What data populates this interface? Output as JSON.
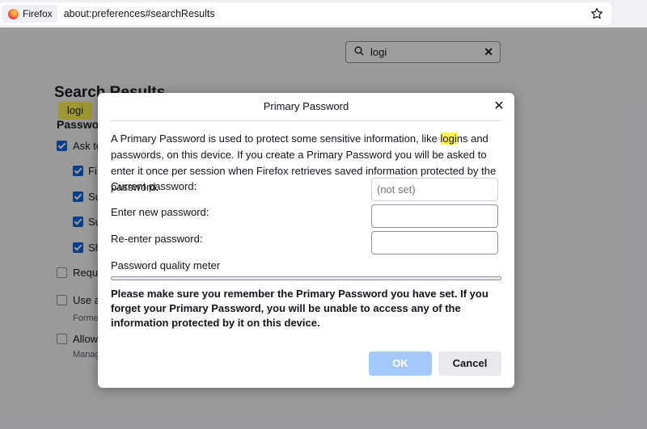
{
  "browser": {
    "identity_label": "Firefox",
    "url": "about:preferences#searchResults"
  },
  "page": {
    "search_query": "logi",
    "title": "Search Results",
    "chip": "logi",
    "section": "Passwo",
    "rows": [
      {
        "label": "Ask to",
        "checked": true
      },
      {
        "label": "Fi",
        "checked": true
      },
      {
        "label": "Su",
        "checked": true
      },
      {
        "label": "Su",
        "checked": true
      },
      {
        "label": "Sh",
        "checked": true
      },
      {
        "label": "Requi",
        "checked": false
      },
      {
        "label": "Use a",
        "checked": false,
        "sub": "Forme"
      },
      {
        "label": "Allow",
        "checked": false,
        "sub": "Manag"
      }
    ]
  },
  "dialog": {
    "title": "Primary Password",
    "description_pre": "A Primary Password is used to protect some sensitive information, like ",
    "description_highlight": "logi",
    "description_post": "ns and passwords, on this device. If you create a Primary Password you will be asked to enter it once per session when Firefox retrieves saved information protected by the password.",
    "current_password_label": "Current password:",
    "current_password_placeholder": "(not set)",
    "new_password_label": "Enter new password:",
    "reenter_password_label": "Re-enter password:",
    "quality_meter_label": "Password quality meter",
    "warning": "Please make sure you remember the Primary Password you have set. If you forget your Primary Password, you will be unable to access any of the information protected by it on this device.",
    "ok_label": "OK",
    "cancel_label": "Cancel"
  },
  "colors": {
    "highlight": "#fff44f",
    "primary_disabled": "#a4c8fa",
    "checkbox_checked": "#0061e0"
  }
}
